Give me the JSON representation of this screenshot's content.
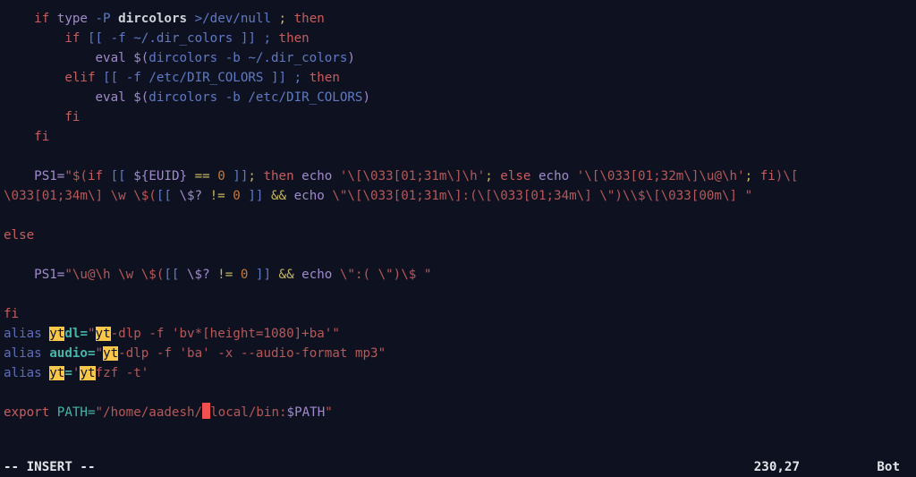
{
  "code": {
    "l01_if": "if",
    "l01_type": " type ",
    "l01_p": "-P",
    "l01_dc": " dircolors ",
    "l01_gt": ">",
    "l01_dn": "/dev/null ",
    "l01_sc": ";",
    "l01_then": " then",
    "l02_if": "if",
    "l02_bb": " [[ ",
    "l02_f": "-f",
    "l02_path": " ~/.dir_colors ",
    "l02_bbe": "]] ;",
    "l02_then": " then",
    "l03_eval": "eval",
    "l03_dol": " $(",
    "l03_dc": "dircolors ",
    "l03_b": "-b",
    "l03_path": " ~/.dir_colors",
    "l03_cl": ")",
    "l04_elif": "elif",
    "l04_bb": " [[ ",
    "l04_f": "-f",
    "l04_path": " /etc/DIR_COLORS ",
    "l04_bbe": "]] ;",
    "l04_then": " then",
    "l05_eval": "eval",
    "l05_dol": " $(",
    "l05_dc": "dircolors ",
    "l05_b": "-b",
    "l05_path": " /etc/DIR_COLORS",
    "l05_cl": ")",
    "l06_fi": "fi",
    "l07_fi": "fi",
    "l08_ps1": "PS1=",
    "l08_a": "\"$(",
    "l08_if": "if",
    "l08_bb": " [[ ",
    "l08_euid": "${EUID}",
    "l08_eq": " == ",
    "l08_zero": "0",
    "l08_bbe": " ]]",
    "l08_sc": ";",
    "l08_then": " then",
    "l08_echo1": " echo ",
    "l08_s1": "'\\[\\033[01;31m\\]\\h'",
    "l08_sc2": ";",
    "l08_else": " else",
    "l08_echo2": " echo ",
    "l08_s2": "'\\[\\033[01;32m\\]\\u@\\h'",
    "l08_sc3": ";",
    "l08_fi": " fi",
    "l08_cl": ")",
    "l08_tail": "\\[",
    "l09_a": "\\033[01;34m\\] \\w \\$(",
    "l09_bb": "[[ ",
    "l09_q": "\\$?",
    "l09_ne": " != ",
    "l09_zero": "0",
    "l09_bbe": " ]]",
    "l09_and": " && ",
    "l09_echo": "echo ",
    "l09_s": "\\\"\\[\\033[01;31m\\]:(\\[\\033[01;34m\\] \\\"",
    "l09_cl": ")",
    "l09_tail": "\\\\$\\[\\033[00m\\] \"",
    "l10_else": "else",
    "l11_ps1": "PS1=",
    "l11_a": "\"\\u@\\h \\w \\$(",
    "l11_bb": "[[ ",
    "l11_q": "\\$?",
    "l11_ne": " != ",
    "l11_zero": "0",
    "l11_bbe": " ]]",
    "l11_and": " && ",
    "l11_echo": "echo ",
    "l11_s": "\\\":( \\\"",
    "l11_cl": ")",
    "l11_tail": "\\$ \"",
    "l12_fi": "fi",
    "a1_kw": "alias",
    "a1_h1": "yt",
    "a1_name": "dl=",
    "a1_q": "\"",
    "a1_h2": "yt",
    "a1_body": "-dlp -f 'bv*[height=1080]+ba'\"",
    "a2_kw": "alias",
    "a2_name": "audio=",
    "a2_q": "\"",
    "a2_h": "yt",
    "a2_body": "-dlp -f 'ba' -x --audio-format mp3\"",
    "a3_kw": "alias",
    "a3_h1": "yt",
    "a3_eq": "=",
    "a3_q1": "'",
    "a3_h2": "yt",
    "a3_body": "fzf -t'",
    "exp_kw": "export",
    "exp_path": "PATH=",
    "exp_q": "\"",
    "exp_a": "/home/aadesh/",
    "exp_b": "local/bin:",
    "exp_var": "$PATH",
    "exp_q2": "\""
  },
  "status": {
    "mode": "-- INSERT --",
    "pos": "230,27",
    "pct": "Bot"
  }
}
